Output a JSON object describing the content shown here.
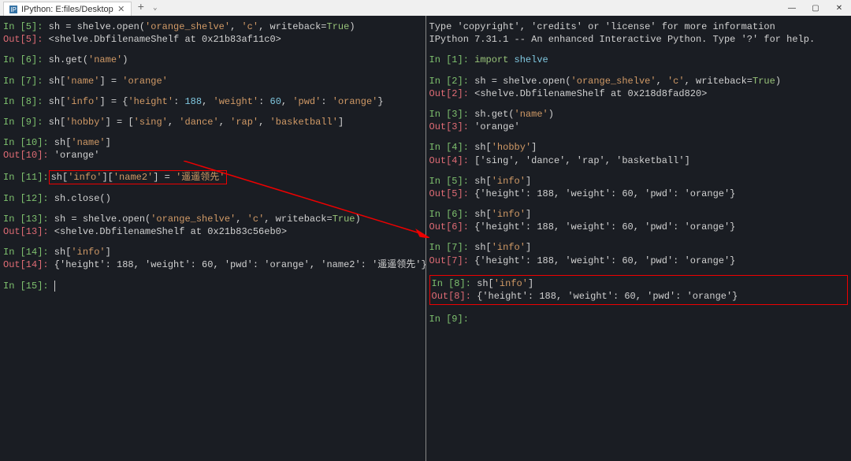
{
  "window": {
    "tab_title": "IPython: E:files/Desktop",
    "newtab": "+",
    "chevron": "⌄",
    "minimize": "—",
    "maximize": "▢",
    "close": "✕"
  },
  "left": {
    "l1_in": "In [5]:",
    "l1": " sh = shelve.open(",
    "l1_s1": "'orange_shelve'",
    "l1_c": ", ",
    "l1_s2": "'c'",
    "l1_kw": ", writeback=",
    "l1_true": "True",
    "l1_end": ")",
    "l2_out": "Out[5]:",
    "l2": " <shelve.DbfilenameShelf at 0x21b83af11c0>",
    "l3_in": "In [6]:",
    "l3": " sh.get(",
    "l3_s": "'name'",
    "l3_end": ")",
    "l4_in": "In [7]:",
    "l4a": " sh[",
    "l4_s1": "'name'",
    "l4b": "] = ",
    "l4_s2": "'orange'",
    "l5_in": "In [8]:",
    "l5a": " sh[",
    "l5_s1": "'info'",
    "l5b": "] = {",
    "l5_k1": "'height'",
    "l5_c1": ": ",
    "l5_v1": "188",
    "l5_c2": ", ",
    "l5_k2": "'weight'",
    "l5_c3": ": ",
    "l5_v2": "60",
    "l5_c4": ", ",
    "l5_k3": "'pwd'",
    "l5_c5": ": ",
    "l5_v3": "'orange'",
    "l5_end": "}",
    "l6_in": "In [9]:",
    "l6a": " sh[",
    "l6_s1": "'hobby'",
    "l6b": "] = [",
    "l6_v1": "'sing'",
    "l6_c1": ", ",
    "l6_v2": "'dance'",
    "l6_c2": ", ",
    "l6_v3": "'rap'",
    "l6_c3": ", ",
    "l6_v4": "'basketball'",
    "l6_end": "]",
    "l7_in": "In [10]:",
    "l7a": " sh[",
    "l7_s": "'name'",
    "l7b": "]",
    "l8_out": "Out[10]:",
    "l8": " 'orange'",
    "l9_in": "In [11]:",
    "l9a": " sh[",
    "l9_s1": "'info'",
    "l9b": "][",
    "l9_s2": "'name2'",
    "l9c": "] = ",
    "l9_s3": "'遥遥领先'",
    "l10_in": "In [12]:",
    "l10": " sh.close()",
    "l11_in": "In [13]:",
    "l11": " sh = shelve.open(",
    "l11_s1": "'orange_shelve'",
    "l11_c": ", ",
    "l11_s2": "'c'",
    "l11_kw": ", writeback=",
    "l11_true": "True",
    "l11_end": ")",
    "l12_out": "Out[13]:",
    "l12": " <shelve.DbfilenameShelf at 0x21b83c56eb0>",
    "l13_in": "In [14]:",
    "l13a": " sh[",
    "l13_s": "'info'",
    "l13b": "]",
    "l14_out": "Out[14]:",
    "l14": " {'height': 188, 'weight': 60, 'pwd': 'orange', 'name2': '遥遥领先'}",
    "l15_in": "In [15]:",
    "l15": " "
  },
  "right": {
    "r1": "Type 'copyright', 'credits' or 'license' for more information",
    "r2a": "IPython 7.31.1 -- An enhanced Interactive Python. Type '?' for help.",
    "r3_in": "In [1]:",
    "r3_imp": " import ",
    "r3_mod": "shelve",
    "r4_in": "In [2]:",
    "r4": " sh = shelve.open(",
    "r4_s1": "'orange_shelve'",
    "r4_c": ", ",
    "r4_s2": "'c'",
    "r4_kw": ", writeback=",
    "r4_true": "True",
    "r4_end": ")",
    "r5_out": "Out[2]:",
    "r5": " <shelve.DbfilenameShelf at 0x218d8fad820>",
    "r6_in": "In [3]:",
    "r6": " sh.get(",
    "r6_s": "'name'",
    "r6_end": ")",
    "r7_out": "Out[3]:",
    "r7": " 'orange'",
    "r8_in": "In [4]:",
    "r8a": " sh[",
    "r8_s": "'hobby'",
    "r8b": "]",
    "r9_out": "Out[4]:",
    "r9": " ['sing', 'dance', 'rap', 'basketball']",
    "r10_in": "In [5]:",
    "r10a": " sh[",
    "r10_s": "'info'",
    "r10b": "]",
    "r11_out": "Out[5]:",
    "r11": " {'height': 188, 'weight': 60, 'pwd': 'orange'}",
    "r12_in": "In [6]:",
    "r12a": " sh[",
    "r12_s": "'info'",
    "r12b": "]",
    "r13_out": "Out[6]:",
    "r13": " {'height': 188, 'weight': 60, 'pwd': 'orange'}",
    "r14_in": "In [7]:",
    "r14a": " sh[",
    "r14_s": "'info'",
    "r14b": "]",
    "r15_out": "Out[7]:",
    "r15": " {'height': 188, 'weight': 60, 'pwd': 'orange'}",
    "r16_in": "In [8]:",
    "r16a": " sh[",
    "r16_s": "'info'",
    "r16b": "]",
    "r17_out": "Out[8]:",
    "r17": " {'height': 188, 'weight': 60, 'pwd': 'orange'}",
    "r18_in": "In [9]:",
    "r18": " "
  }
}
